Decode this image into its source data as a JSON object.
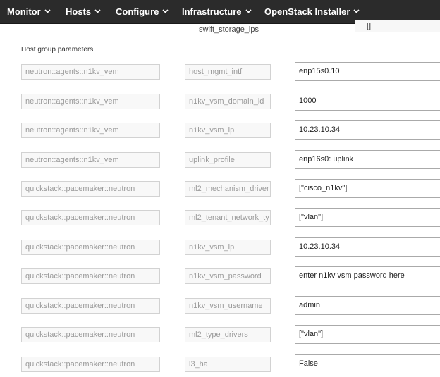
{
  "nav": {
    "items": [
      {
        "label": "Monitor"
      },
      {
        "label": "Hosts"
      },
      {
        "label": "Configure"
      },
      {
        "label": "Infrastructure"
      },
      {
        "label": "OpenStack Installer"
      }
    ]
  },
  "previous_row": {
    "label": "swift_storage_ips",
    "value": "[]"
  },
  "section": {
    "title": "Host group parameters"
  },
  "parameters": [
    {
      "class": "neutron::agents::n1kv_vem",
      "key": "host_mgmt_intf",
      "value": "enp15s0.10"
    },
    {
      "class": "neutron::agents::n1kv_vem",
      "key": "n1kv_vsm_domain_id",
      "value": "1000"
    },
    {
      "class": "neutron::agents::n1kv_vem",
      "key": "n1kv_vsm_ip",
      "value": "10.23.10.34"
    },
    {
      "class": "neutron::agents::n1kv_vem",
      "key": "uplink_profile",
      "value": "enp16s0: uplink"
    },
    {
      "class": "quickstack::pacemaker::neutron",
      "key": "ml2_mechanism_driver",
      "value": "[\"cisco_n1kv\"]"
    },
    {
      "class": "quickstack::pacemaker::neutron",
      "key": "ml2_tenant_network_ty",
      "value": "[\"vlan\"]"
    },
    {
      "class": "quickstack::pacemaker::neutron",
      "key": "n1kv_vsm_ip",
      "value": "10.23.10.34"
    },
    {
      "class": "quickstack::pacemaker::neutron",
      "key": "n1kv_vsm_password",
      "value": "enter n1kv vsm password here"
    },
    {
      "class": "quickstack::pacemaker::neutron",
      "key": "n1kv_vsm_username",
      "value": "admin"
    },
    {
      "class": "quickstack::pacemaker::neutron",
      "key": "ml2_type_drivers",
      "value": "[\"vlan\"]"
    },
    {
      "class": "quickstack::pacemaker::neutron",
      "key": "l3_ha",
      "value": "False"
    }
  ]
}
